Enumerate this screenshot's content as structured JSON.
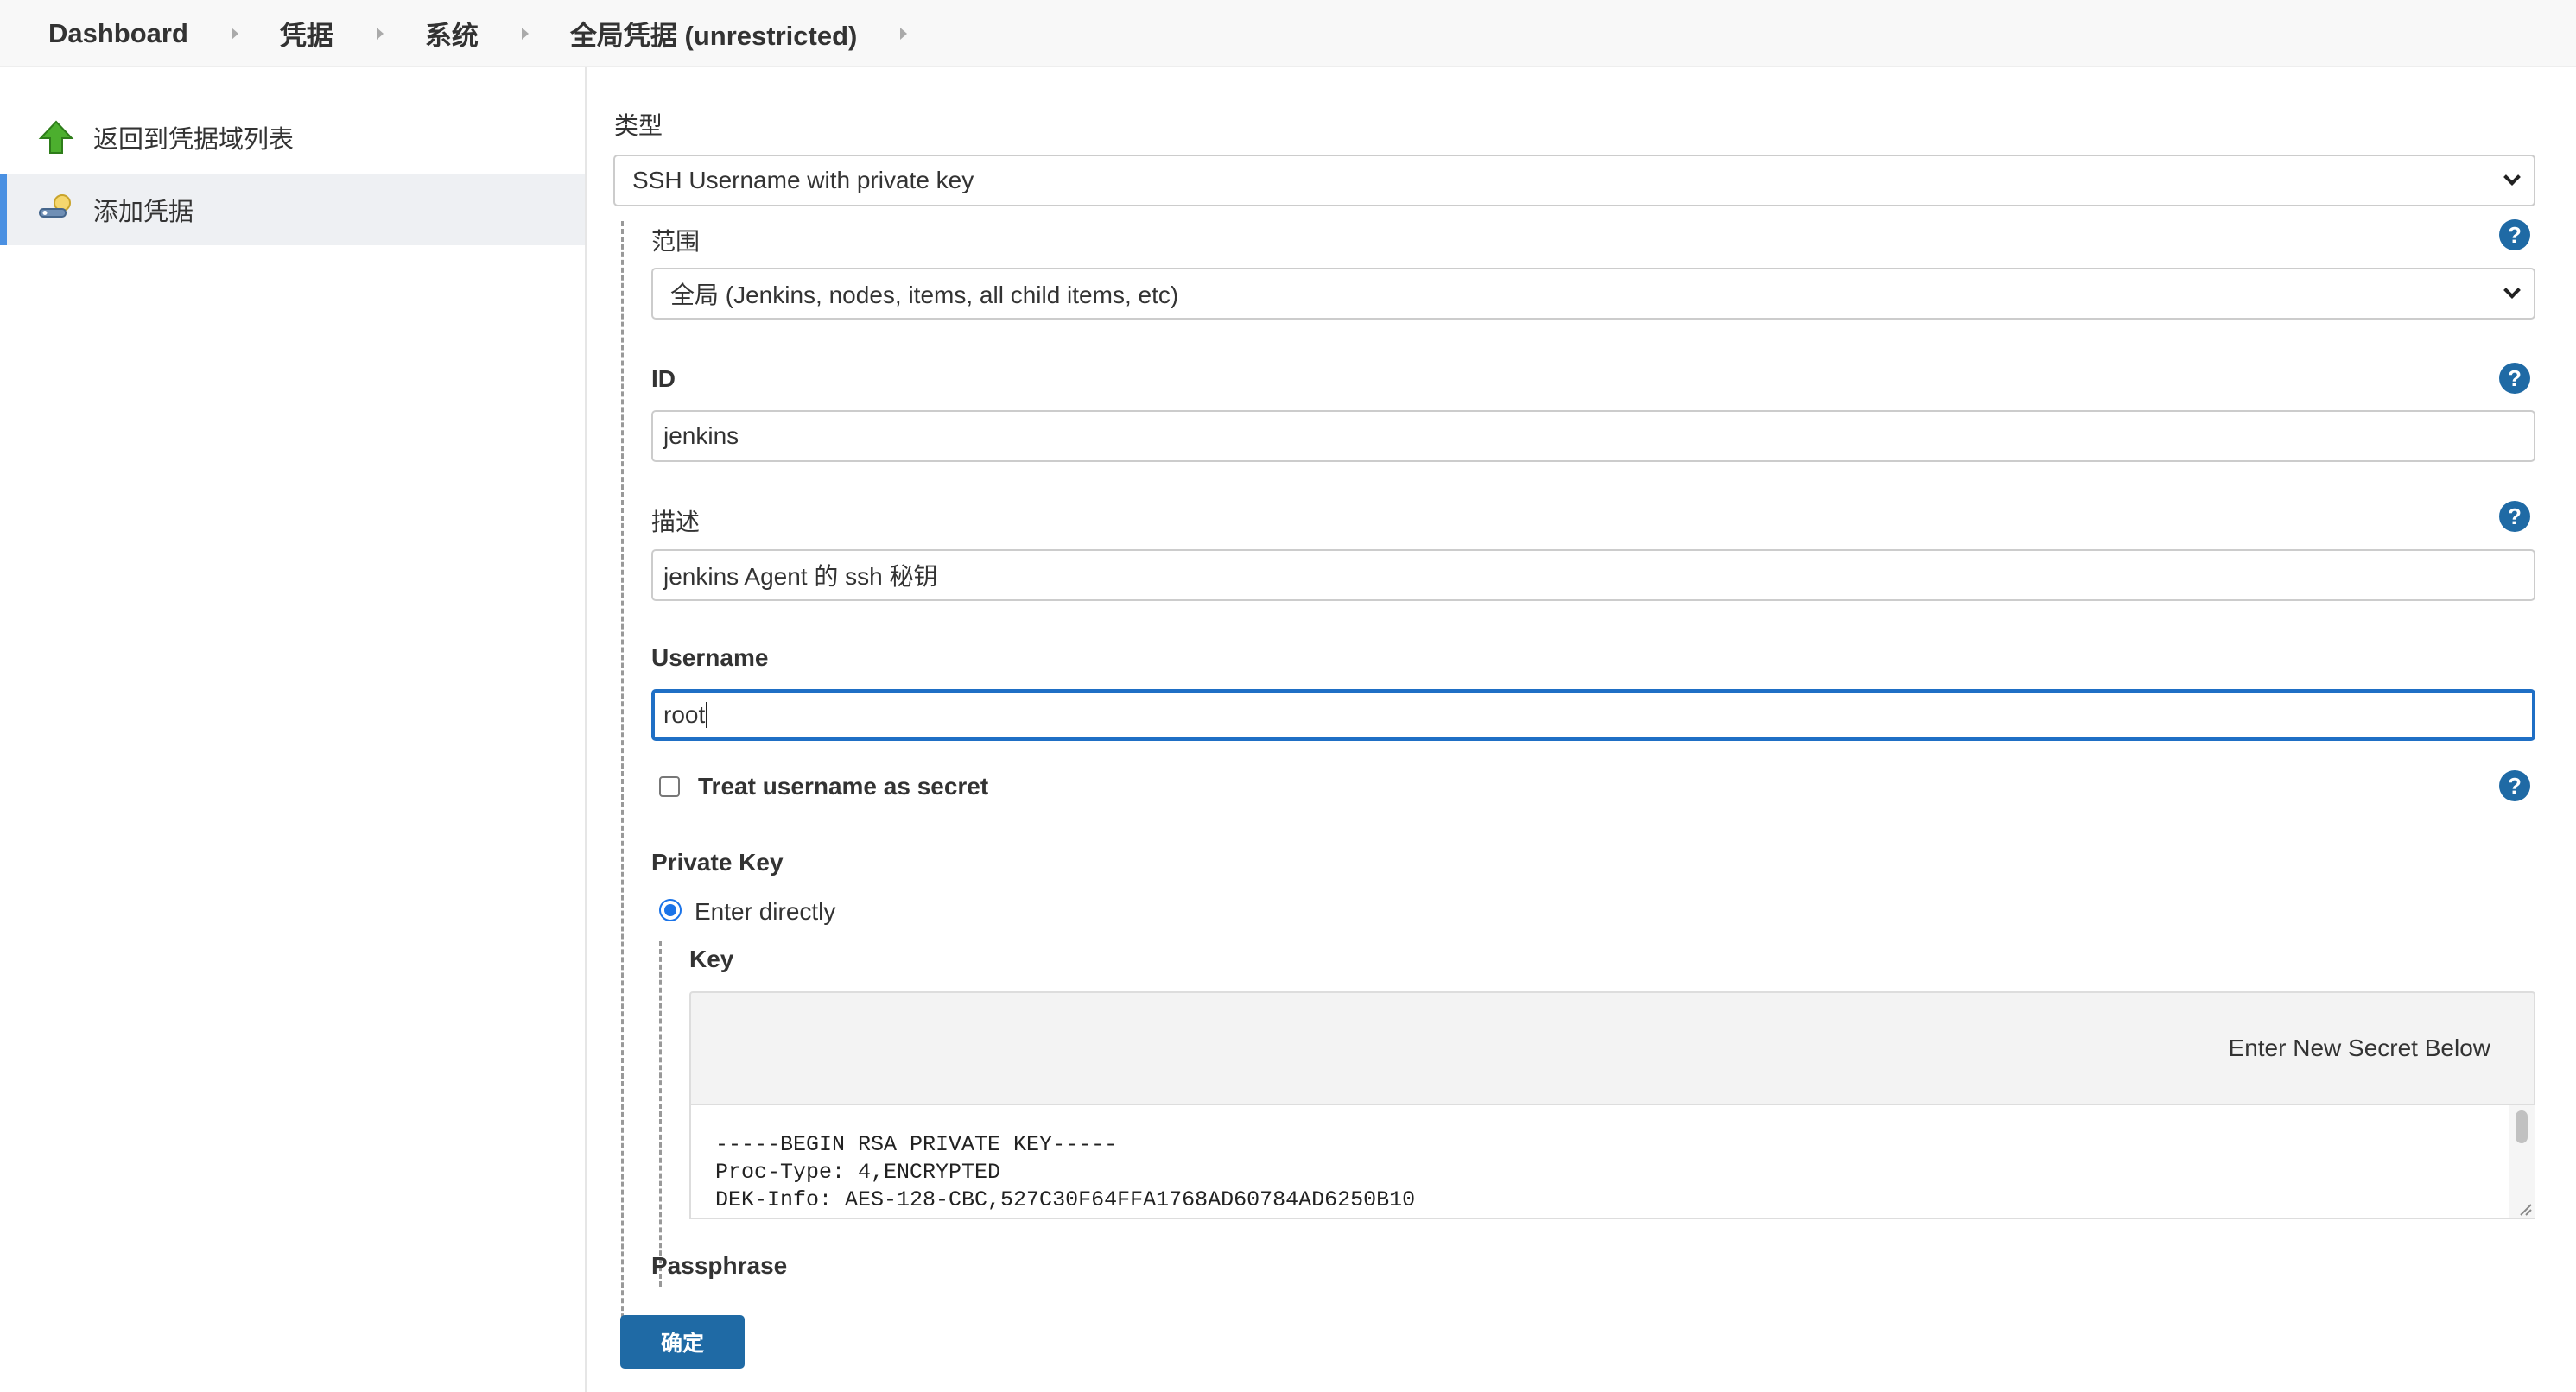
{
  "breadcrumb": {
    "items": [
      "Dashboard",
      "凭据",
      "系统",
      "全局凭据 (unrestricted)"
    ]
  },
  "sidebar": {
    "back_label": "返回到凭据域列表",
    "add_label": "添加凭据"
  },
  "form": {
    "kind_label": "类型",
    "kind_value": "SSH Username with private key",
    "scope_label": "范围",
    "scope_value": "全局 (Jenkins, nodes, items, all child items, etc)",
    "id_label": "ID",
    "id_value": "jenkins",
    "description_label": "描述",
    "description_value": "jenkins Agent 的 ssh 秘钥",
    "username_label": "Username",
    "username_value": "root",
    "treat_secret_label": "Treat username as secret",
    "private_key_label": "Private Key",
    "enter_directly_label": "Enter directly",
    "key_label": "Key",
    "enter_new_secret": "Enter New Secret Below",
    "key_lines": [
      "-----BEGIN RSA PRIVATE KEY-----",
      "Proc-Type: 4,ENCRYPTED",
      "DEK-Info: AES-128-CBC,527C30F64FFA1768AD60784AD6250B10"
    ],
    "passphrase_label": "Passphrase",
    "help_glyph": "?",
    "submit_label": "确定"
  },
  "colors": {
    "primary": "#1f6aa5",
    "focus": "#1f6fc5",
    "active_bar": "#4a90e2",
    "arrow_green": "#4caf2e"
  },
  "icons": {
    "back": "green-up-arrow-icon",
    "add": "key-icon",
    "help": "help-icon"
  }
}
